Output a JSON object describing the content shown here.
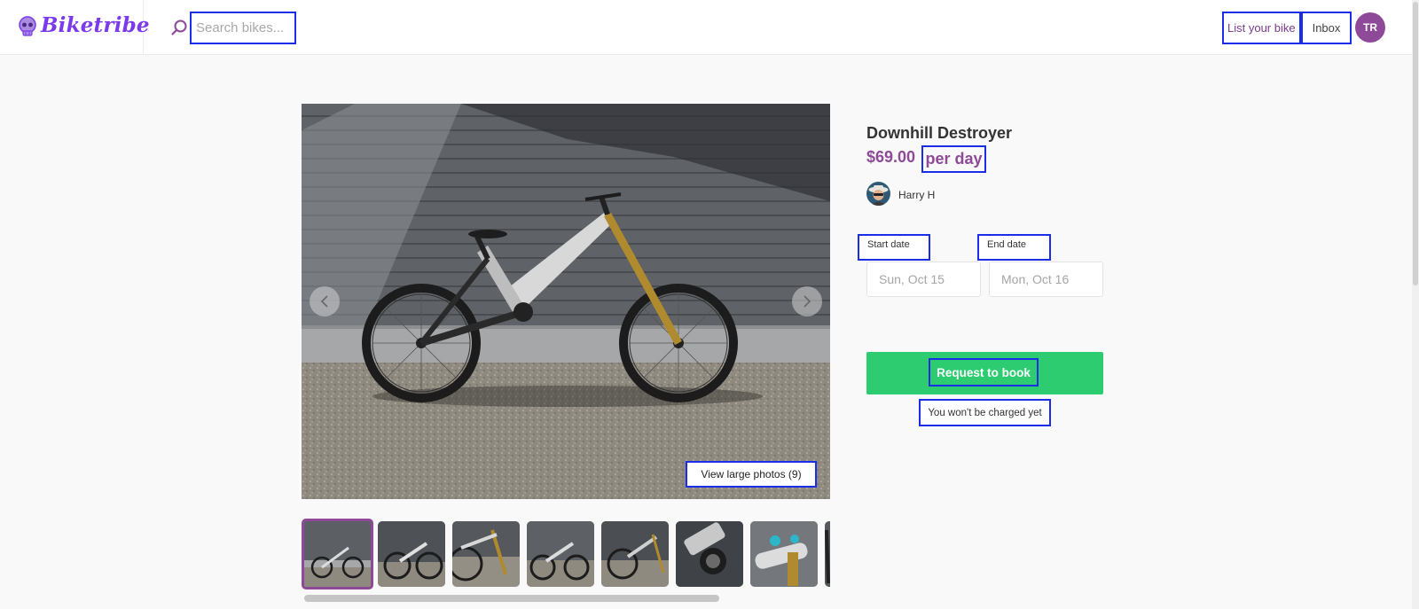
{
  "app": {
    "logo_text": "Biketribe",
    "brand_color": "#7c3aed",
    "accent_color": "#8e4a98"
  },
  "header": {
    "search_placeholder": "Search bikes...",
    "search_value": "",
    "list_bike_label": "List your bike",
    "inbox_label": "Inbox",
    "user_initials": "TR"
  },
  "listing": {
    "title": "Downhill Destroyer",
    "price": "$69.00",
    "price_unit": "per day",
    "owner_name": "Harry H",
    "view_photos_label": "View large photos (9)",
    "thumbnail_count": 8,
    "active_thumbnail": 0
  },
  "booking": {
    "start_label": "Start date",
    "end_label": "End date",
    "start_placeholder": "Sun, Oct 15",
    "end_placeholder": "Mon, Oct 16",
    "book_label": "Request to book",
    "book_color": "#2ecc71",
    "note": "You won't be charged yet"
  }
}
